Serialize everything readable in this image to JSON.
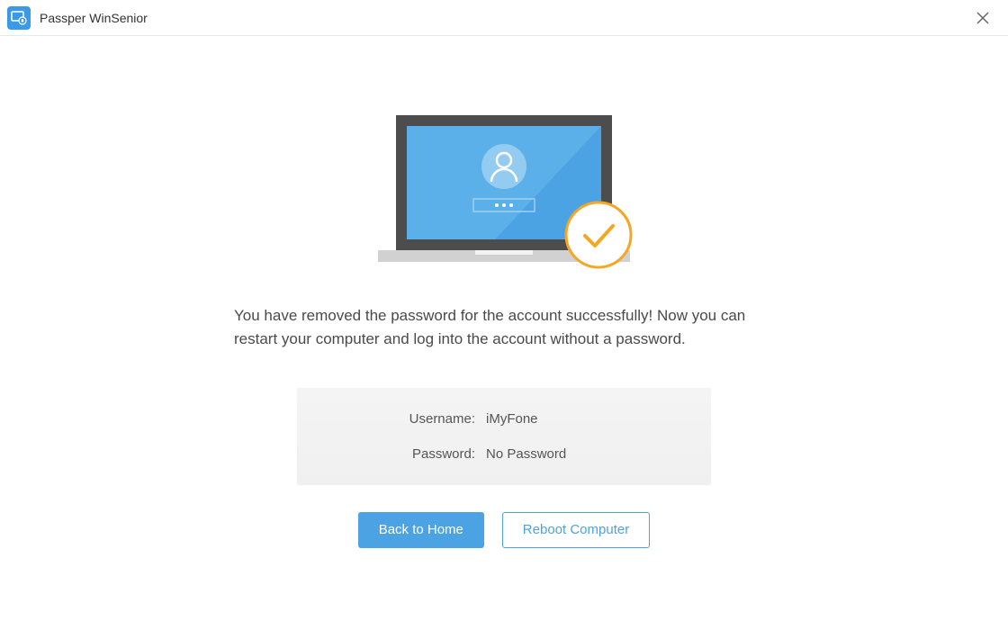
{
  "header": {
    "app_title": "Passper WinSenior"
  },
  "main": {
    "message": "You have removed the password for the account successfully! Now you can restart your computer and log into the account without a password.",
    "info": {
      "username_label": "Username:",
      "username_value": "iMyFone",
      "password_label": "Password:",
      "password_value": "No Password"
    },
    "buttons": {
      "back_home": "Back to Home",
      "reboot": "Reboot Computer"
    }
  },
  "colors": {
    "primary": "#4ba3e3",
    "accent_orange": "#f5a623",
    "laptop_bezel": "#4d4d4d",
    "laptop_base": "#d1d1d1",
    "screen_blue": "#4ba3e3"
  }
}
